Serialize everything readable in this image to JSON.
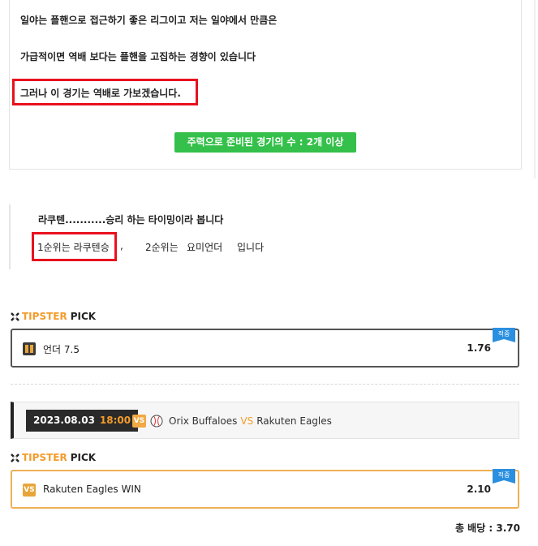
{
  "article": {
    "line1": "일야는 플핸으로 접근하기 좋은 리그이고   저는 일야에서 만큼은",
    "line2": "가급적이면   역배 보다는 플핸을 고집하는 경향이 있습니다",
    "line3": "그러나 이 경기는 역배로 가보겠습니다.",
    "button_label": "주력으로 준비된 경기의 수 : 2개 이상"
  },
  "quote": {
    "line1": "라쿠텐...........승리 하는 타이밍이라 봅니다",
    "first_place": "1순위는 라쿠텐승",
    "comma": ",",
    "second_place": "2순위는",
    "second_value": "요미언더",
    "ending": "입니다"
  },
  "tipster_header": {
    "part1": "TIPSTER",
    "part2": "PICK"
  },
  "picks": [
    {
      "label": "언더 7.5",
      "odds": "1.76",
      "badge": "적중",
      "icon": "over-under-icon"
    },
    {
      "label": "Rakuten Eagles WIN",
      "odds": "2.10",
      "badge": "적중",
      "icon": "vs-icon"
    }
  ],
  "match": {
    "date": "2023.08.03",
    "time": "18:00",
    "vs_icon_text": "VS",
    "home": "Orix Buffaloes",
    "vs": "VS",
    "away": "Rakuten Eagles"
  },
  "total_odds": "총 배당 : 3.70",
  "colors": {
    "accent_orange": "#f39c2b",
    "highlight_red": "#e8111e",
    "button_green": "#34c04a",
    "badge_blue": "#2b8fe0"
  }
}
